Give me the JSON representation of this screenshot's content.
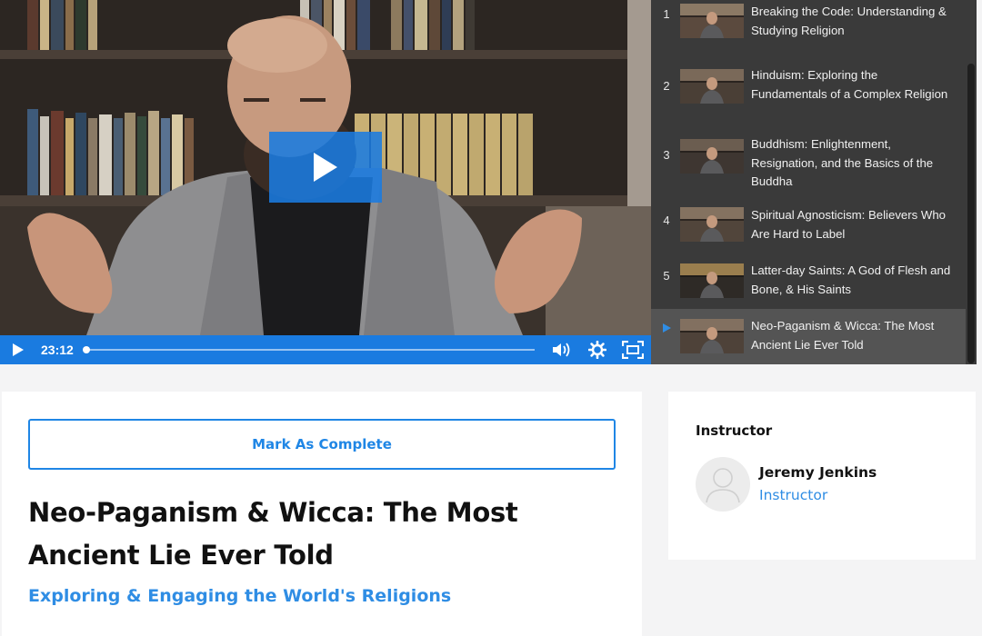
{
  "video": {
    "time": "23:12",
    "progress": 0.0
  },
  "icons": {
    "play": "play-icon",
    "volume": "volume-icon",
    "settings": "gear-icon",
    "fullscreen": "fullscreen-icon",
    "now_playing": "now-playing-icon",
    "avatar": "user-avatar-icon"
  },
  "playlist": {
    "items": [
      {
        "number": "1",
        "title": "Breaking the Code: Understanding & Studying Religion",
        "active": false
      },
      {
        "number": "2",
        "title": "Hinduism: Exploring the Fundamentals of a Complex Religion",
        "active": false
      },
      {
        "number": "3",
        "title": "Buddhism: Enlightenment, Resignation, and the Basics of the Buddha",
        "active": false
      },
      {
        "number": "4",
        "title": "Spiritual Agnosticism: Believers Who Are Hard to Label",
        "active": false
      },
      {
        "number": "5",
        "title": "Latter-day Saints: A God of Flesh and Bone, & His Saints",
        "active": false
      },
      {
        "number": "",
        "title": "Neo-Paganism & Wicca: The Most Ancient Lie Ever Told",
        "active": true
      }
    ]
  },
  "lesson": {
    "mark_complete_label": "Mark As Complete",
    "title": "Neo-Paganism & Wicca: The Most Ancient Lie Ever Told",
    "course": "Exploring & Engaging the World's Religions"
  },
  "instructor": {
    "heading": "Instructor",
    "name": "Jeremy Jenkins",
    "role": "Instructor"
  },
  "colors": {
    "accent": "#1f86e5",
    "control_bar": "#1a7be0",
    "playlist_bg": "#3a3a3a",
    "playlist_active": "#545454"
  }
}
